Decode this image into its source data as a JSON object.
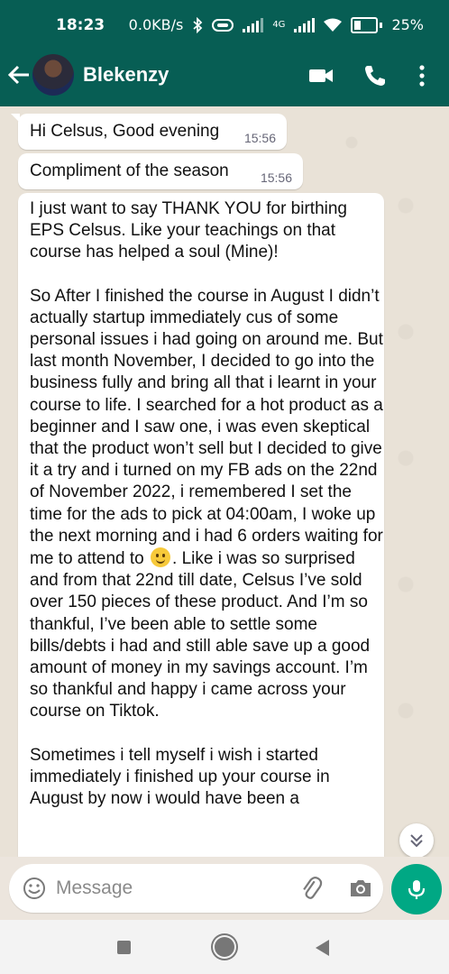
{
  "status_bar": {
    "time": "18:23",
    "net_speed": "0.0KB/s",
    "network_type": "4G",
    "battery": "25%"
  },
  "header": {
    "contact_name": "Blekenzy"
  },
  "messages": [
    {
      "text": "Hi Celsus, Good evening",
      "time": "15:56"
    },
    {
      "text": "Compliment of the season",
      "time": "15:56"
    }
  ],
  "long_message": {
    "paragraph1": "I just want to say THANK YOU for birthing EPS Celsus. Like your teachings on that course has helped a soul (Mine)!",
    "paragraph2_part1": "So After I finished the course in August I didn’t actually startup immediately cus of some personal issues i had going on around me. But last month November, I decided to go into the business fully and bring all that i learnt in your course to life. I searched for a hot product as a beginner and I saw one, i was even skeptical that the product won’t sell but I decided to give it a try and i turned on my FB ads on the 22nd of November 2022, i remembered I set the time for the ads to pick at 04:00am, I woke up the next morning and i had 6 orders waiting for me to attend to",
    "paragraph2_part2": ". Like i was so surprised and from that 22nd till date, Celsus I’ve sold over 150 pieces of these product. And I’m so thankful, I’ve been able to settle some bills/debts i had and still able save up a good amount of money in my savings account. I’m so thankful and happy i came across your course on Tiktok.",
    "paragraph3": "Sometimes i tell myself i wish i started immediately i finished up your course in August by now i would have been a"
  },
  "composer": {
    "placeholder": "Message"
  },
  "colors": {
    "header_bg": "#075e54",
    "chat_bg": "#e9e2d7",
    "mic_button": "#00a884"
  }
}
